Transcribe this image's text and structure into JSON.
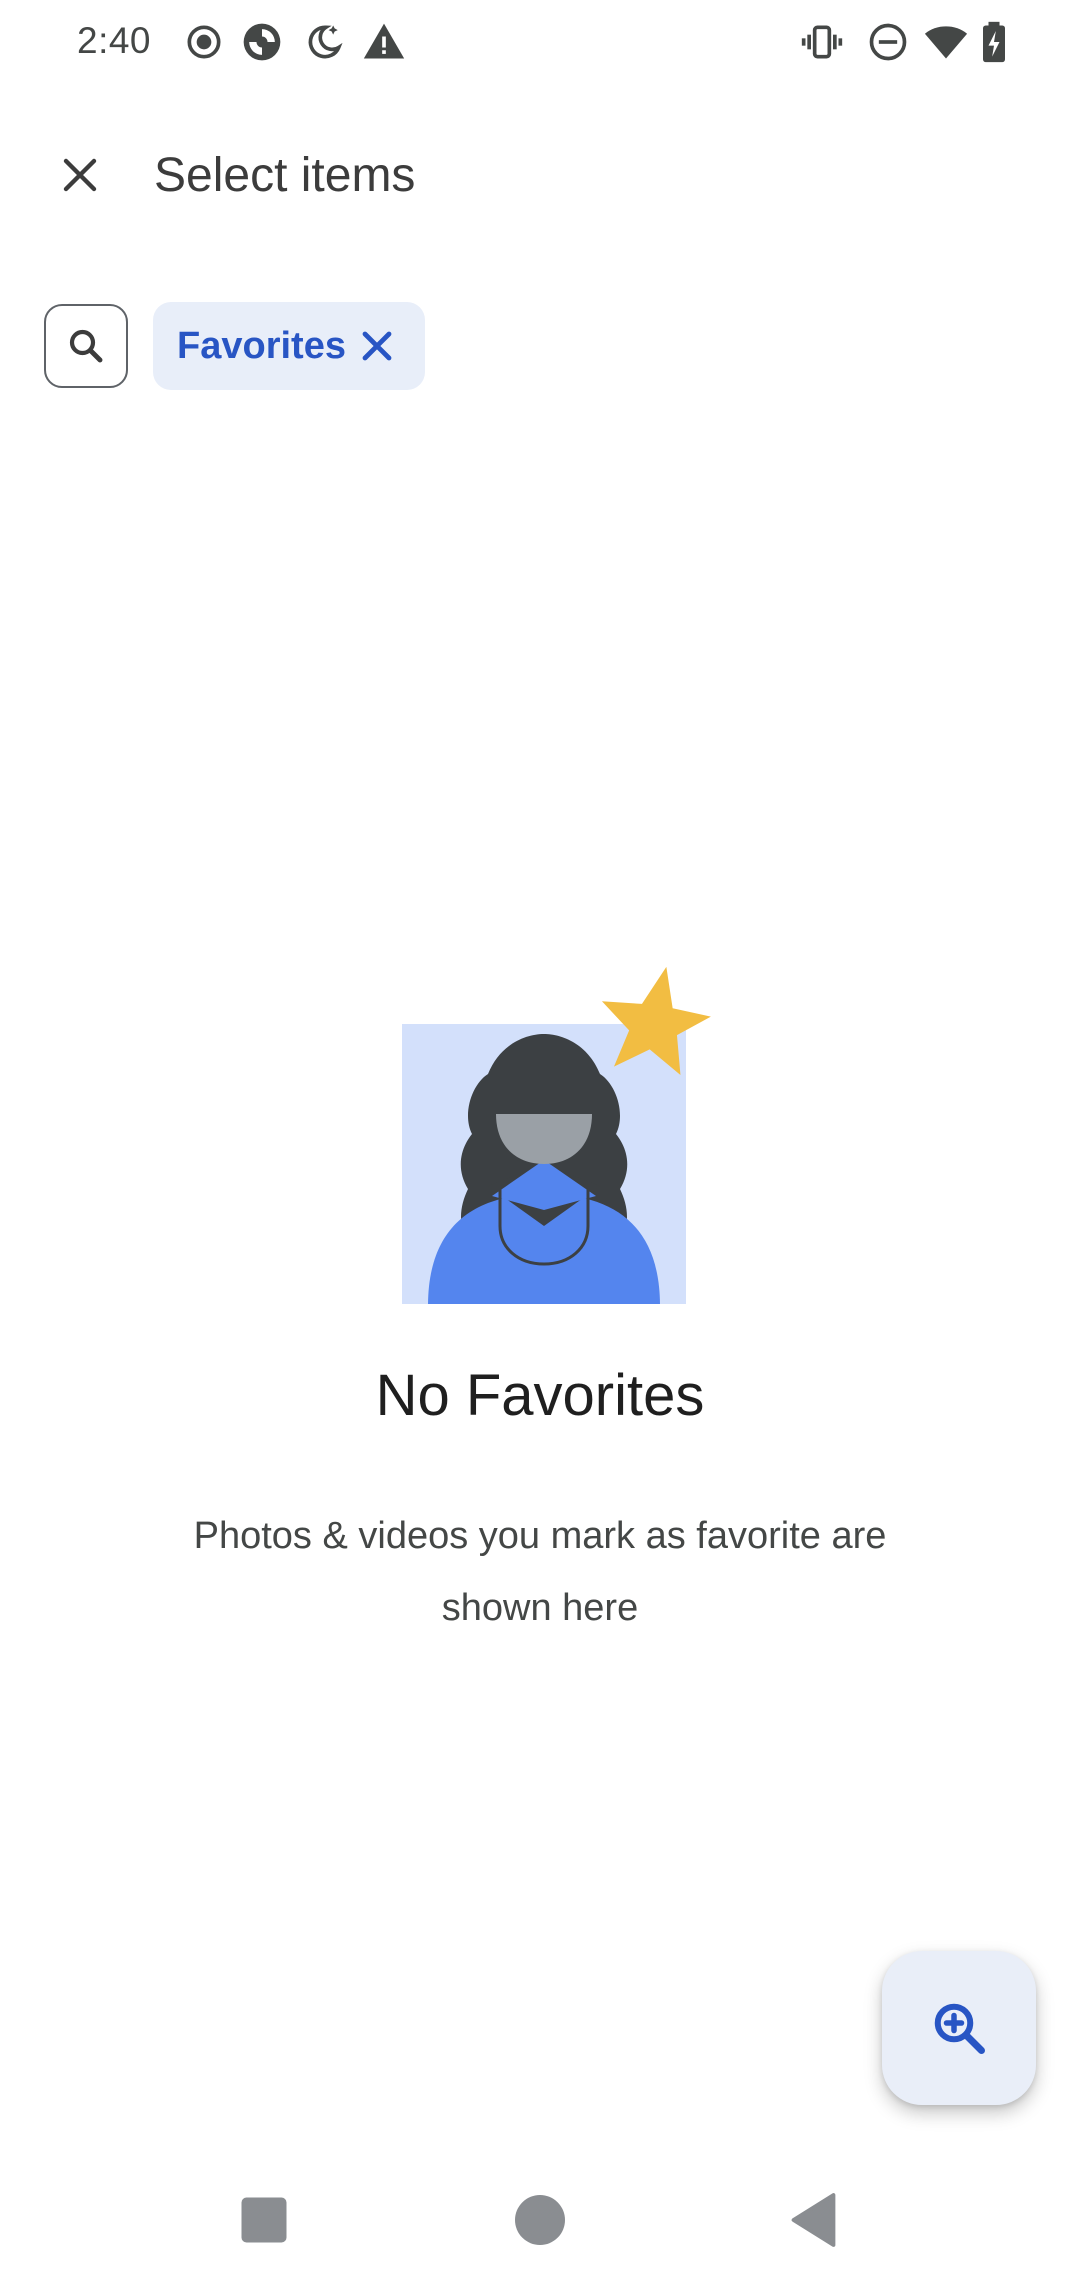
{
  "status_bar": {
    "time": "2:40",
    "icons_left": [
      "record-icon",
      "app-ring-icon",
      "night-mode-icon",
      "warning-icon"
    ],
    "icons_right": [
      "vibrate-icon",
      "do-not-disturb-icon",
      "wifi-icon",
      "battery-charging-icon"
    ]
  },
  "top_bar": {
    "close_icon": "close-icon",
    "title": "Select items"
  },
  "chips": {
    "search_icon": "search-icon",
    "filter_label": "Favorites",
    "filter_close_icon": "close-icon"
  },
  "empty_state": {
    "illustration": "favorites-person-star-illustration",
    "title": "No Favorites",
    "description": "Photos & videos you mark as favorite are shown here"
  },
  "fab": {
    "icon": "zoom-in-icon"
  },
  "nav_bar": {
    "items": [
      "recents-square-icon",
      "home-circle-icon",
      "back-triangle-icon"
    ]
  },
  "colors": {
    "accent": "#2855c4",
    "chip_bg": "#e8eef9",
    "star": "#f2bd42",
    "illustration_bg": "#d3e0fb",
    "illustration_blue": "#5485ee"
  }
}
